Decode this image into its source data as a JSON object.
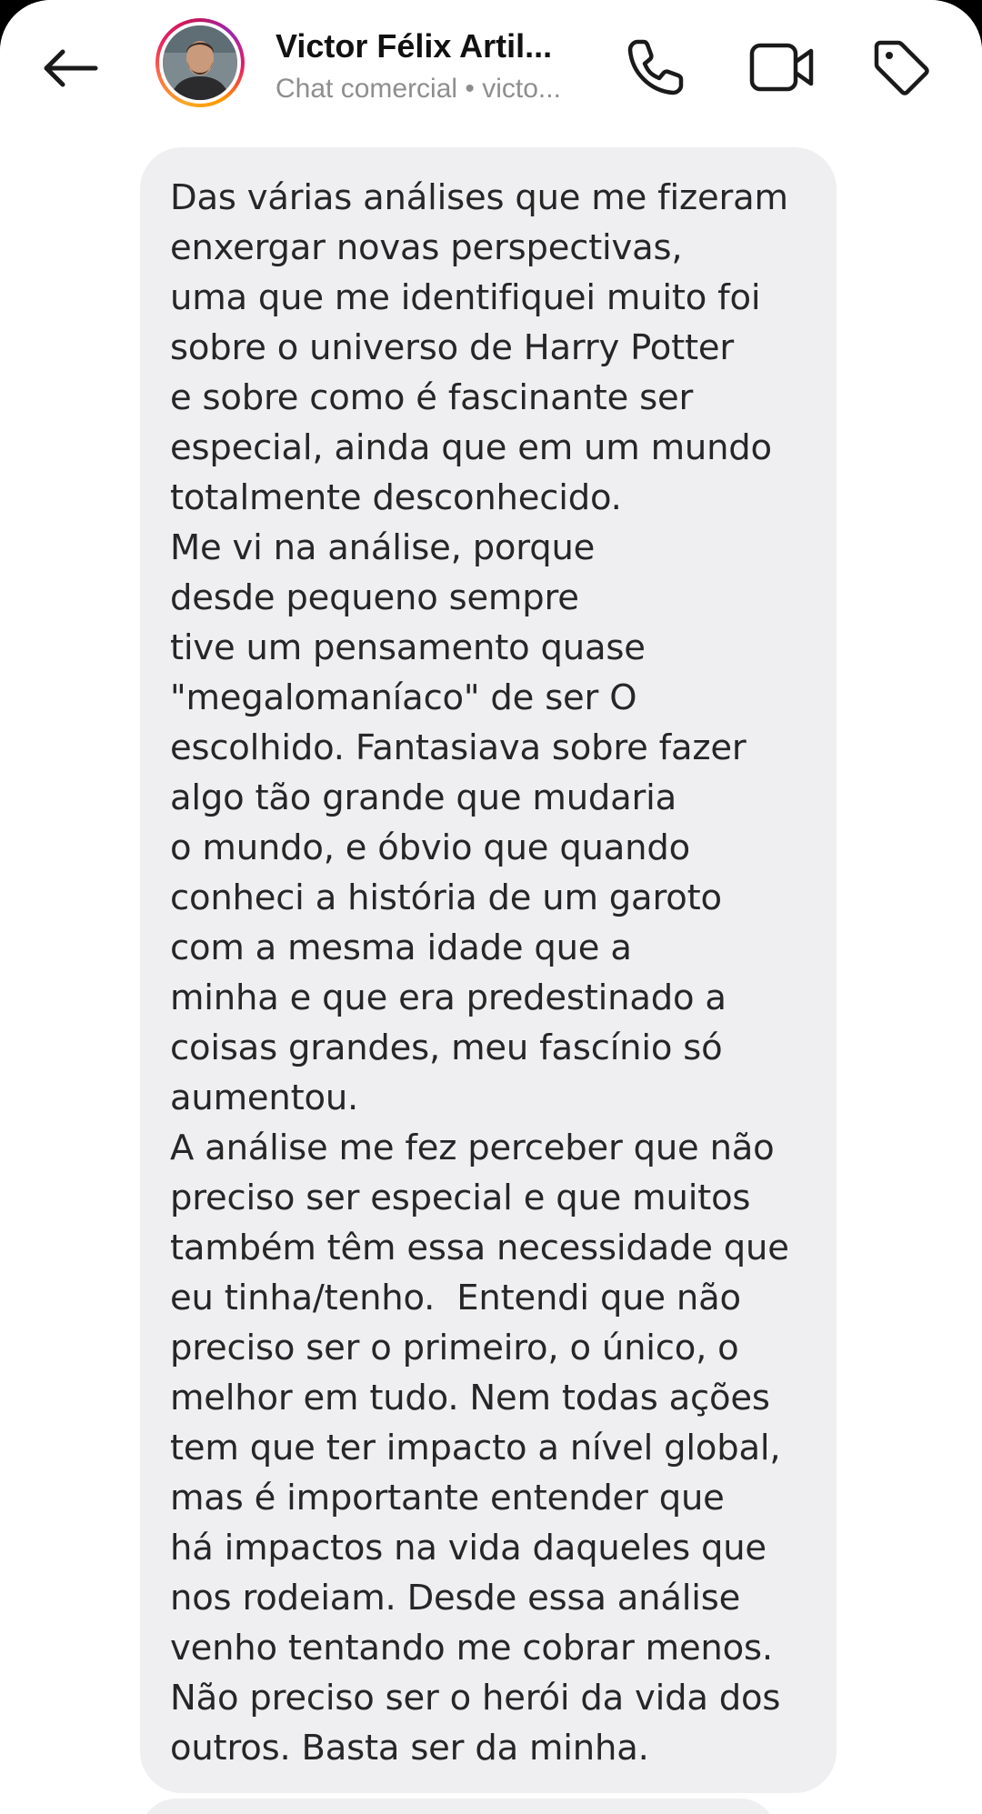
{
  "header": {
    "contact_name": "Victor Félix Artil...",
    "subtitle": "Chat comercial • victo...",
    "icons": {
      "back": "arrow-left-icon",
      "call": "phone-icon",
      "video": "video-camera-icon",
      "label": "tag-icon"
    },
    "avatar_ring_colors": [
      "#f9a825",
      "#e91e63",
      "#9c27b0"
    ]
  },
  "message": {
    "text": "Das várias análises que me fizeram\nenxergar novas perspectivas,\numa que me identifiquei muito foi\nsobre o universo de Harry Potter\ne sobre como é fascinante ser\nespecial, ainda que em um mundo\ntotalmente desconhecido.\nMe vi na análise, porque\ndesde pequeno sempre\ntive um pensamento quase\n\"megalomaníaco\" de ser O\nescolhido. Fantasiava sobre fazer\nalgo tão grande que mudaria\no mundo, e óbvio que quando\nconheci a história de um garoto\ncom a mesma idade que a\nminha e que era predestinado a\ncoisas grandes, meu fascínio só\naumentou.\nA análise me fez perceber que não\npreciso ser especial e que muitos\ntambém têm essa necessidade que\neu tinha/tenho.  Entendi que não\npreciso ser o primeiro, o único, o\nmelhor em tudo. Nem todas ações\ntem que ter impacto a nível global,\nmas é importante entender que\nhá impactos na vida daqueles que\nnos rodeiam. Desde essa análise\nvenho tentando me cobrar menos.\nNão preciso ser o herói da vida dos\noutros. Basta ser da minha.",
    "bubble_color": "#efeff1",
    "text_color": "#262626"
  }
}
